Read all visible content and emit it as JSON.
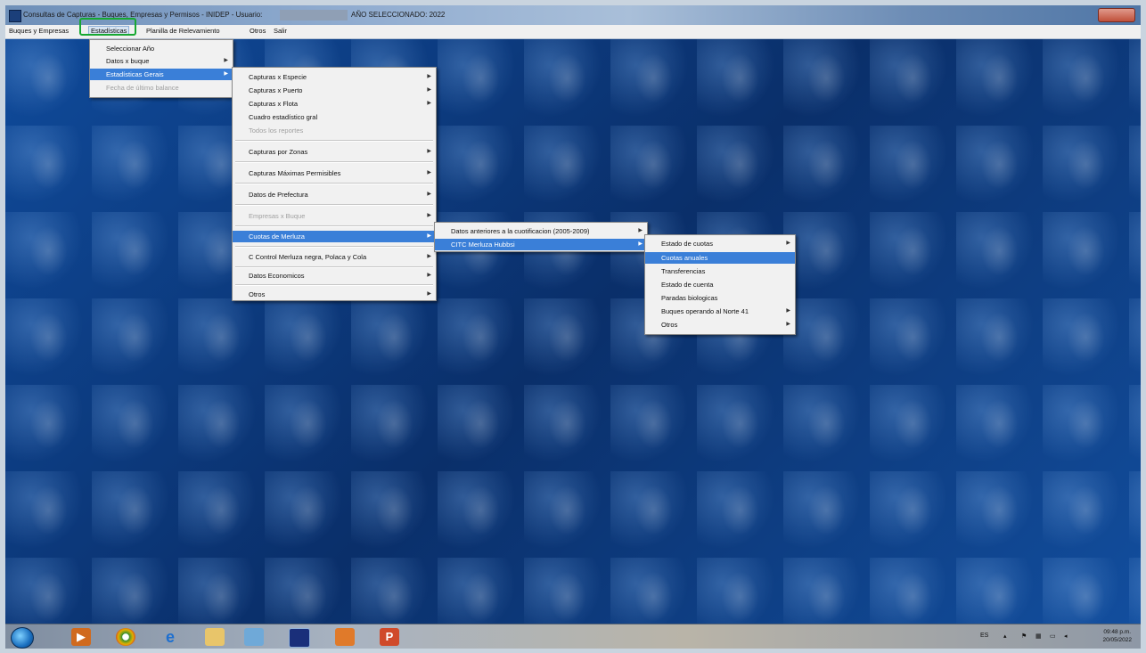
{
  "window": {
    "title": "Consultas de Capturas - Buques, Empresas y Permisos - INIDEP - Usuario:",
    "title_suffix": "AÑO SELECCIONADO: 2022"
  },
  "menubar": {
    "items": [
      "Buques y Empresas",
      "Estadísticas",
      "Planilla de Relevamiento",
      "Otros",
      "Salir"
    ]
  },
  "menu_estadisticas": {
    "items": [
      {
        "label": "Seleccionar Año",
        "arrow": ""
      },
      {
        "label": "Datos x buque",
        "arrow": "▶"
      },
      {
        "label": "Estadísticas Gerais",
        "arrow": "▶"
      },
      {
        "label": "Fecha de último balance",
        "arrow": ""
      }
    ]
  },
  "menu_estadisticas_generales": {
    "items": [
      {
        "label": "Capturas x Especie",
        "arrow": "▶"
      },
      {
        "label": "Capturas x Puerto",
        "arrow": "▶"
      },
      {
        "label": "Capturas x Flota",
        "arrow": "▶"
      },
      {
        "label": "Cuadro estadístico gral",
        "arrow": ""
      },
      {
        "label": "Todos los reportes",
        "arrow": ""
      },
      {
        "label": "Capturas por Zonas",
        "arrow": "▶"
      },
      {
        "label": "Capturas Máximas Permisibles",
        "arrow": "▶"
      },
      {
        "label": "Datos de Prefectura",
        "arrow": "▶"
      },
      {
        "label": "Empresas x Buque",
        "arrow": "▶"
      },
      {
        "label": "Cuotas de Merluza",
        "arrow": "▶"
      },
      {
        "label": "C Control Merluza negra, Polaca y Cola",
        "arrow": "▶"
      },
      {
        "label": "Datos Economicos",
        "arrow": "▶"
      },
      {
        "label": "Otros",
        "arrow": "▶"
      }
    ]
  },
  "menu_cuotas_merluza": {
    "items": [
      {
        "label": "Datos anteriores a la cuotificacion (2005-2009)",
        "arrow": "▶"
      },
      {
        "label": "CITC Merluza Hubbsi",
        "arrow": "▶"
      }
    ]
  },
  "menu_citc": {
    "items": [
      {
        "label": "Estado de cuotas",
        "arrow": "▶"
      },
      {
        "label": "Cuotas anuales",
        "arrow": ""
      },
      {
        "label": "Transferencias",
        "arrow": ""
      },
      {
        "label": "Estado de cuenta",
        "arrow": ""
      },
      {
        "label": "Paradas biologicas",
        "arrow": ""
      },
      {
        "label": "Buques operando al Norte 41",
        "arrow": "▶"
      },
      {
        "label": "Otros",
        "arrow": "▶"
      }
    ]
  },
  "taskbar": {
    "tray": "ES",
    "time": "09:48 p.m.",
    "date": "20/05/2022"
  }
}
